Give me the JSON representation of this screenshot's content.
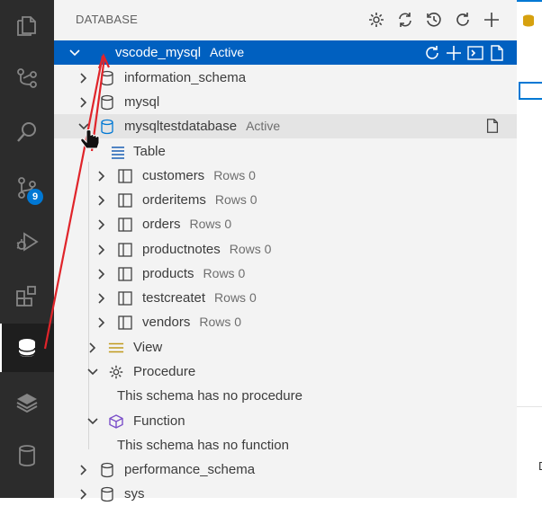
{
  "panel": {
    "title": "DATABASE"
  },
  "activity": {
    "scm_badge": "9"
  },
  "header_actions": [
    "settings-icon",
    "sync-icon",
    "history-icon",
    "refresh-icon",
    "add-icon"
  ],
  "connection": {
    "name": "vscode_mysql",
    "status": "Active"
  },
  "schemas": [
    {
      "name": "information_schema"
    },
    {
      "name": "mysql"
    },
    {
      "name": "mysqltestdatabase",
      "status": "Active"
    }
  ],
  "table_group": {
    "label": "Table"
  },
  "tables": [
    {
      "name": "customers",
      "rows": "Rows 0"
    },
    {
      "name": "orderitems",
      "rows": "Rows 0"
    },
    {
      "name": "orders",
      "rows": "Rows 0"
    },
    {
      "name": "productnotes",
      "rows": "Rows 0"
    },
    {
      "name": "products",
      "rows": "Rows 0"
    },
    {
      "name": "testcreatet",
      "rows": "Rows 0"
    },
    {
      "name": "vendors",
      "rows": "Rows 0"
    }
  ],
  "view_group": {
    "label": "View"
  },
  "procedure_group": {
    "label": "Procedure",
    "empty": "This schema has no procedure"
  },
  "function_group": {
    "label": "Function",
    "empty": "This schema has no function"
  },
  "more_schemas": [
    {
      "name": "performance_schema"
    },
    {
      "name": "sys"
    }
  ],
  "editor": {
    "letter": "D"
  },
  "colors": {
    "selection": "#0060c0",
    "accent": "#0078d4",
    "annotation_arrow": "#e0242a"
  }
}
